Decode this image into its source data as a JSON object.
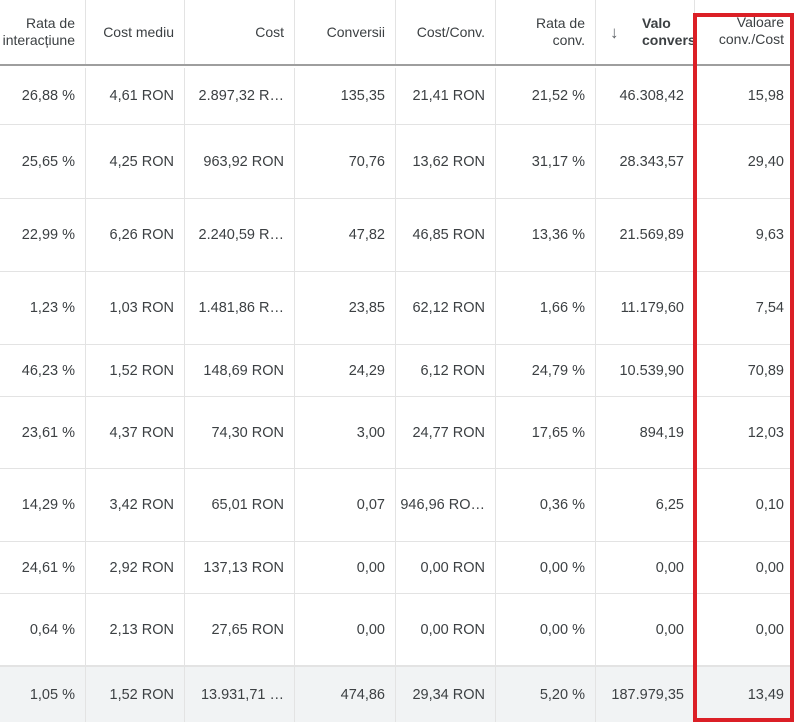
{
  "columns": [
    {
      "key": "interaction_rate",
      "label": "Rata de\ninteracțiune"
    },
    {
      "key": "avg_cost",
      "label": "Cost mediu"
    },
    {
      "key": "cost",
      "label": "Cost"
    },
    {
      "key": "conversions",
      "label": "Conversii"
    },
    {
      "key": "cost_per_conv",
      "label": "Cost/Conv."
    },
    {
      "key": "conv_rate",
      "label": "Rata de\nconv."
    },
    {
      "key": "conv_value",
      "label": "Valo\nconvers",
      "sort_icon": "arrow-down-icon"
    },
    {
      "key": "conv_value_per_cost",
      "label": "Valoare\nconv./Cost"
    }
  ],
  "rows": [
    [
      "26,88 %",
      "4,61 RON",
      "2.897,32 R…",
      "135,35",
      "21,41 RON",
      "21,52 %",
      "46.308,42",
      "15,98"
    ],
    [
      "25,65 %",
      "4,25 RON",
      "963,92 RON",
      "70,76",
      "13,62 RON",
      "31,17 %",
      "28.343,57",
      "29,40"
    ],
    [
      "22,99 %",
      "6,26 RON",
      "2.240,59 R…",
      "47,82",
      "46,85 RON",
      "13,36 %",
      "21.569,89",
      "9,63"
    ],
    [
      "1,23 %",
      "1,03 RON",
      "1.481,86 R…",
      "23,85",
      "62,12 RON",
      "1,66 %",
      "11.179,60",
      "7,54"
    ],
    [
      "46,23 %",
      "1,52 RON",
      "148,69 RON",
      "24,29",
      "6,12 RON",
      "24,79 %",
      "10.539,90",
      "70,89"
    ],
    [
      "23,61 %",
      "4,37 RON",
      "74,30 RON",
      "3,00",
      "24,77 RON",
      "17,65 %",
      "894,19",
      "12,03"
    ],
    [
      "14,29 %",
      "3,42 RON",
      "65,01 RON",
      "0,07",
      "946,96 RO…",
      "0,36 %",
      "6,25",
      "0,10"
    ],
    [
      "24,61 %",
      "2,92 RON",
      "137,13 RON",
      "0,00",
      "0,00 RON",
      "0,00 %",
      "0,00",
      "0,00"
    ],
    [
      "0,64 %",
      "2,13 RON",
      "27,65 RON",
      "0,00",
      "0,00 RON",
      "0,00 %",
      "0,00",
      "0,00"
    ]
  ],
  "totals": [
    "1,05 %",
    "1,52 RON",
    "13.931,71 …",
    "474,86",
    "29,34 RON",
    "5,20 %",
    "187.979,35",
    "13,49"
  ],
  "highlight_color": "#db1f26"
}
